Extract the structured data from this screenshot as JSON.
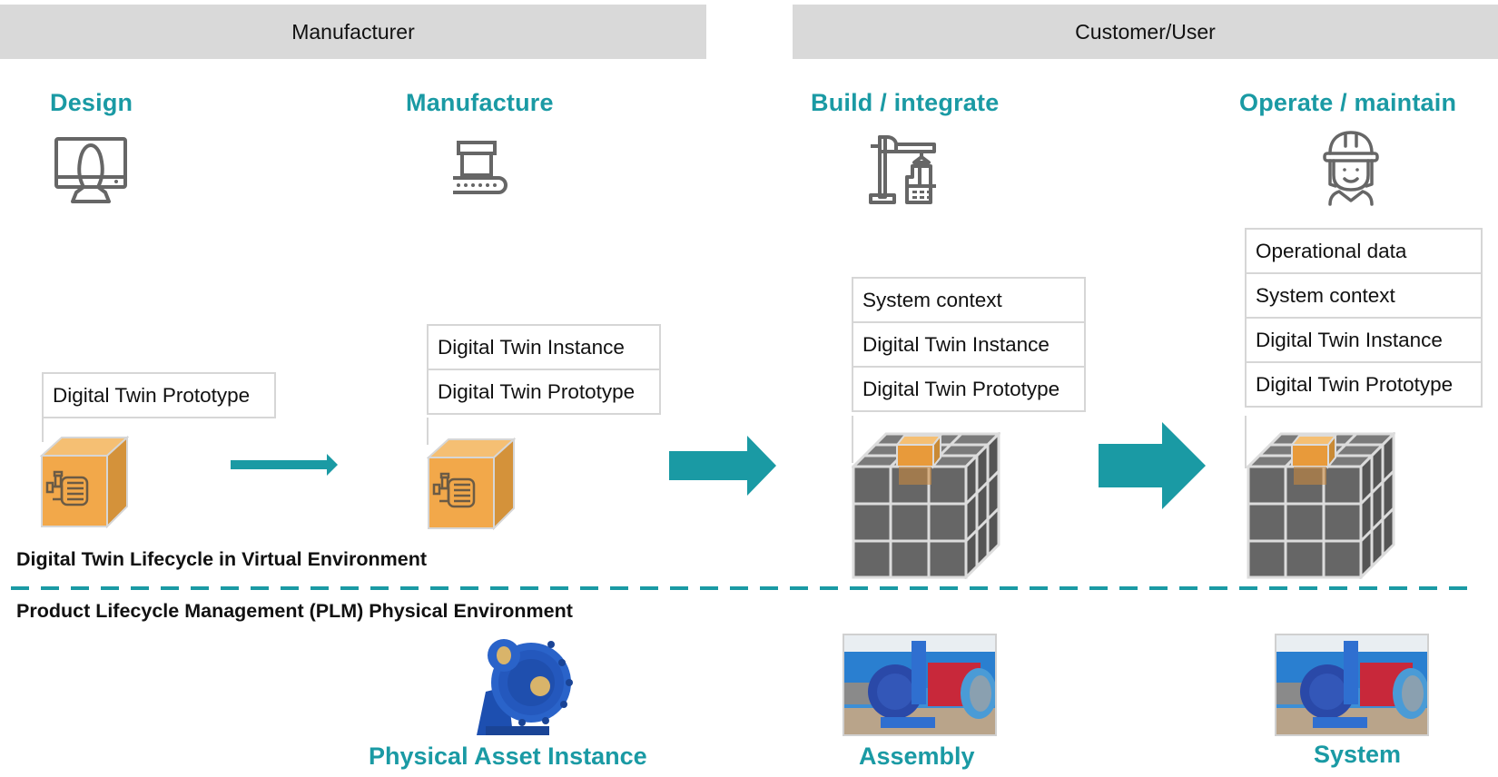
{
  "header": {
    "manufacturer": "Manufacturer",
    "customer": "Customer/User"
  },
  "phases": [
    {
      "label": "Design",
      "icon": "designer-at-monitor-icon"
    },
    {
      "label": "Manufacture",
      "icon": "conveyor-production-icon"
    },
    {
      "label": "Build / integrate",
      "icon": "crane-building-icon"
    },
    {
      "label": "Operate / maintain",
      "icon": "female-worker-hardhat-icon"
    }
  ],
  "stacks": {
    "design": [
      "Digital Twin Prototype"
    ],
    "manufacture": [
      "Digital Twin Instance",
      "Digital Twin Prototype"
    ],
    "build": [
      "System context",
      "Digital Twin Instance",
      "Digital Twin Prototype"
    ],
    "operate": [
      "Operational  data",
      "System context",
      "Digital Twin Instance",
      "Digital Twin Prototype"
    ]
  },
  "sections": {
    "virtual": "Digital Twin Lifecycle in Virtual Environment",
    "physical": "Product Lifecycle Management (PLM)  Physical Environment"
  },
  "physical": {
    "asset": "Physical Asset Instance",
    "assembly": "Assembly",
    "system": "System"
  },
  "colors": {
    "accent": "#1a9aa4",
    "band": "#d9d9d9",
    "cube_orange": "#f2a84a",
    "cube_gray": "#6b6b6b"
  }
}
